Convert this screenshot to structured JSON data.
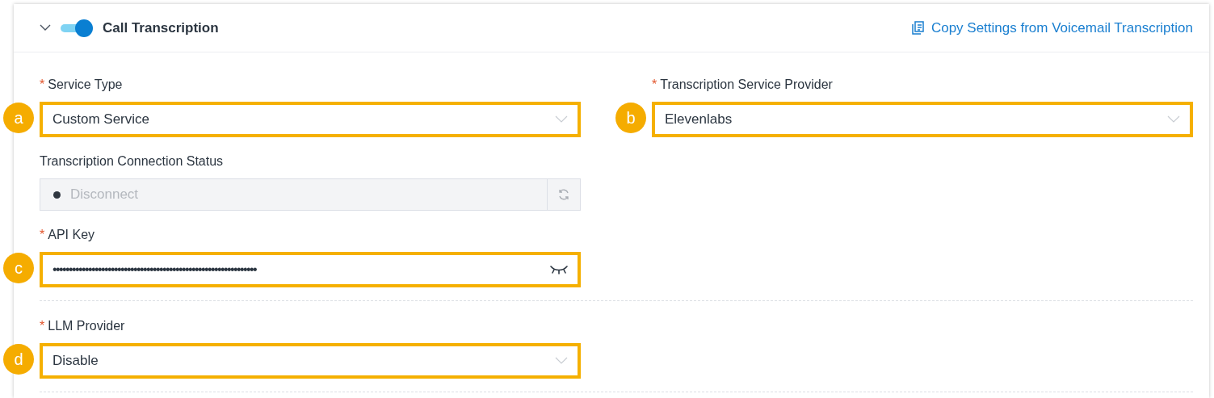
{
  "section": {
    "title": "Call Transcription",
    "expanded": true,
    "enabled": true,
    "copy_link": "Copy Settings from Voicemail Transcription"
  },
  "groups": [
    {
      "rows": [
        [
          {
            "kind": "select",
            "label": "Service Type",
            "required_mark": "*",
            "value": "Custom Service",
            "marker": "a"
          },
          {
            "kind": "select",
            "label": "Transcription Service Provider",
            "required_mark": "*",
            "value": "Elevenlabs",
            "marker": "b"
          }
        ],
        [
          {
            "kind": "status",
            "label": "Transcription Connection Status",
            "value": "Disconnect",
            "disabled": true
          }
        ],
        [
          {
            "kind": "password",
            "label": "API Key",
            "required_mark": "*",
            "value": "•••••••••••••••••••••••••••••••••••••••••••••••••••••••••••••••",
            "marker": "c"
          }
        ]
      ]
    },
    {
      "rows": [
        [
          {
            "kind": "select",
            "label": "LLM Provider",
            "required_mark": "*",
            "value": "Disable",
            "marker": "d"
          }
        ]
      ]
    }
  ]
}
